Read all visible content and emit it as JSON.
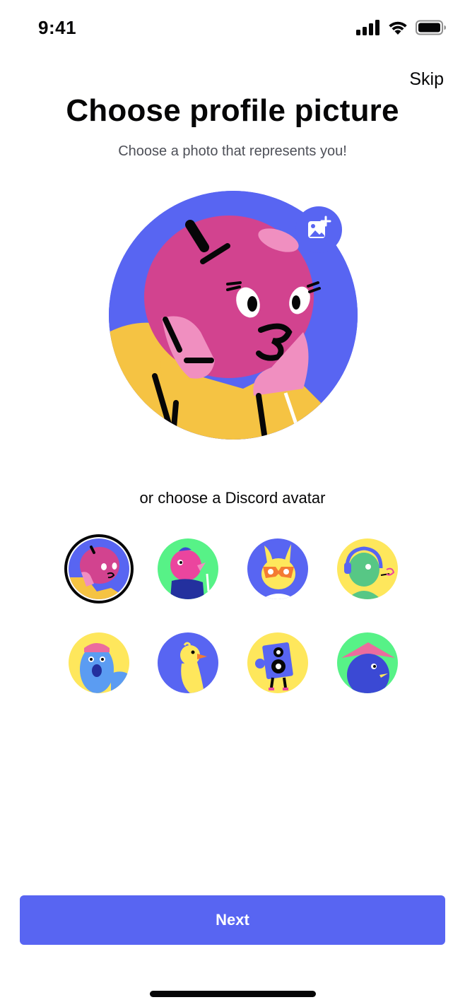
{
  "status_bar": {
    "time": "9:41",
    "icons": [
      "signal-icon",
      "wifi-icon",
      "battery-icon"
    ]
  },
  "header": {
    "skip_label": "Skip",
    "title": "Choose profile picture",
    "subtitle": "Choose a photo that represents you!"
  },
  "profile_picture": {
    "current_avatar": "pink-apple-avatar",
    "upload_icon": "add-image-icon"
  },
  "avatars": {
    "heading": "or choose a Discord avatar",
    "selected_index": 0,
    "items": [
      {
        "name": "pink-apple-avatar",
        "bg": "#5865f2"
      },
      {
        "name": "pink-bird-avatar",
        "bg": "#57f287"
      },
      {
        "name": "yellow-bunny-avatar",
        "bg": "#5865f2"
      },
      {
        "name": "green-headset-avatar",
        "bg": "#fee75c"
      },
      {
        "name": "blue-cap-avatar",
        "bg": "#fee75c"
      },
      {
        "name": "yellow-duck-avatar",
        "bg": "#5865f2"
      },
      {
        "name": "speaker-robot-avatar",
        "bg": "#fee75c"
      },
      {
        "name": "book-hat-avatar",
        "bg": "#57f287"
      }
    ]
  },
  "footer": {
    "next_label": "Next"
  },
  "colors": {
    "brand": "#5865f2",
    "text": "#060607",
    "muted": "#4e5058"
  }
}
